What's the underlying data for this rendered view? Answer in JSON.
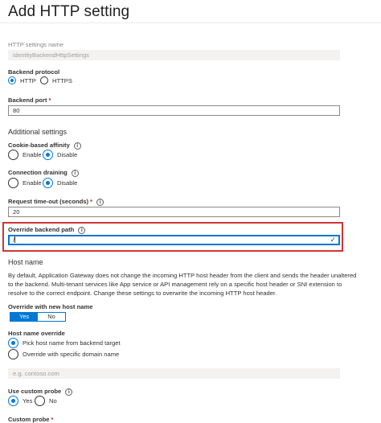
{
  "panel": {
    "title": "Add HTTP setting"
  },
  "http_settings_name": {
    "label": "HTTP settings name",
    "value": "identityBackendHttpSettings"
  },
  "backend_protocol": {
    "label": "Backend protocol",
    "options": [
      "HTTP",
      "HTTPS"
    ],
    "selected": "HTTP"
  },
  "backend_port": {
    "label": "Backend port",
    "required": "*",
    "value": "80"
  },
  "additional_settings": {
    "title": "Additional settings"
  },
  "cookie_affinity": {
    "label": "Cookie-based affinity",
    "info": "i",
    "options": [
      "Enable",
      "Disable"
    ],
    "selected": "Disable"
  },
  "connection_draining": {
    "label": "Connection draining",
    "info": "i",
    "options": [
      "Enable",
      "Disable"
    ],
    "selected": "Disable"
  },
  "request_timeout": {
    "label": "Request time-out (seconds)",
    "required": "*",
    "info": "i",
    "value": "20"
  },
  "override_backend_path": {
    "label": "Override backend path",
    "info": "i",
    "value": "/",
    "valid_icon": "checkmark-icon",
    "highlight_color": "#d13438"
  },
  "host_name": {
    "title": "Host name",
    "description": "By default, Application Gateway does not change the incoming HTTP host header from the client and sends the header unaltered to the backend. Multi-tenant services like App service or API management rely on a specific host header or SNI extension to resolve to the correct endpoint. Change these settings to overwrite the incoming HTTP host header."
  },
  "override_with_new_host_name": {
    "label": "Override with new host name",
    "options": [
      "Yes",
      "No"
    ],
    "selected": "Yes"
  },
  "host_name_override": {
    "label": "Host name override",
    "options": [
      "Pick host name from backend target",
      "Override with specific domain name"
    ],
    "selected": "Pick host name from backend target",
    "domain_placeholder": "e.g. contoso.com"
  },
  "use_custom_probe": {
    "label": "Use custom probe",
    "info": "i",
    "options": [
      "Yes",
      "No"
    ],
    "selected": "Yes"
  },
  "custom_probe": {
    "label": "Custom probe",
    "required": "*"
  },
  "colors": {
    "accent": "#0078d4",
    "required": "#a4262c",
    "success": "#107c10"
  }
}
